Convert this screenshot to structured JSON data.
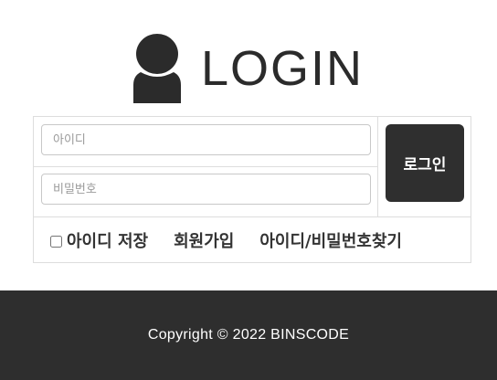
{
  "header": {
    "logo_icon": "user-silhouette-icon",
    "title": "LOGIN"
  },
  "login_form": {
    "id_placeholder": "아이디",
    "password_placeholder": "비밀번호",
    "id_value": "",
    "password_value": "",
    "submit_label": "로그인",
    "remember_checked": false,
    "remember_label": "아이디 저장",
    "signup_label": "회원가입",
    "find_label": "아이디/비밀번호찾기"
  },
  "footer": {
    "copyright": "Copyright © 2022 BINSCODE"
  },
  "colors": {
    "dark": "#2e2e2e",
    "border": "#dddddd",
    "text": "#333333"
  }
}
